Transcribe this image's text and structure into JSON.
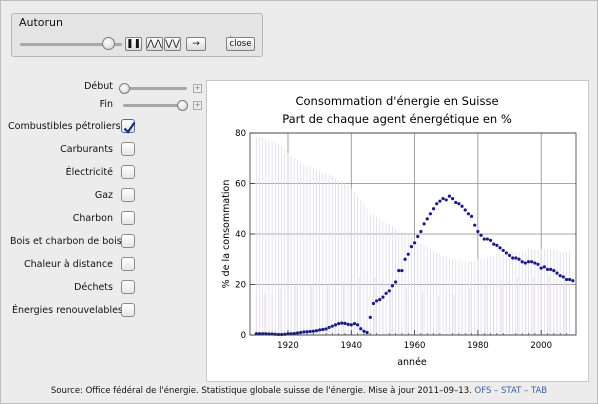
{
  "autorun": {
    "title": "Autorun",
    "slider_level": 0.85,
    "buttons": {
      "pause": "❚❚",
      "faster": "⋀⋀",
      "slower": "⋁⋁",
      "step": "→",
      "close": "close"
    }
  },
  "controls": {
    "debut": {
      "label": "Début",
      "level": 0
    },
    "fin": {
      "label": "Fin",
      "level": 1
    },
    "checkboxes": [
      {
        "label": "Combustibles pétroliers",
        "checked": true
      },
      {
        "label": "Carburants",
        "checked": false
      },
      {
        "label": "Électricité",
        "checked": false
      },
      {
        "label": "Gaz",
        "checked": false
      },
      {
        "label": "Charbon",
        "checked": false
      },
      {
        "label": "Bois et charbon de bois",
        "checked": false
      },
      {
        "label": "Chaleur à distance",
        "checked": false
      },
      {
        "label": "Déchets",
        "checked": false
      },
      {
        "label": "Énergies renouvelables",
        "checked": false
      }
    ]
  },
  "chart_data": {
    "type": "scatter",
    "title": "Consommation d'énergie en Suisse",
    "subtitle": "Part de chaque agent énergétique en %",
    "xlabel": "année",
    "ylabel": "% de la consommation",
    "xlim": [
      1908,
      2011
    ],
    "ylim": [
      0,
      80
    ],
    "xticks": [
      1920,
      1940,
      1960,
      1980,
      2000
    ],
    "yticks": [
      0,
      20,
      40,
      60,
      80
    ],
    "grid": true,
    "point_color": "#1b1b86",
    "series": [
      {
        "x": [
          1910,
          1911,
          1912,
          1913,
          1914,
          1915,
          1916,
          1917,
          1918,
          1919,
          1920,
          1921,
          1922,
          1923,
          1924,
          1925,
          1926,
          1927,
          1928,
          1929,
          1930,
          1931,
          1932,
          1933,
          1934,
          1935,
          1936,
          1937,
          1938,
          1939,
          1940,
          1941,
          1942,
          1943,
          1944,
          1945,
          1946,
          1947,
          1948,
          1949,
          1950,
          1951,
          1952,
          1953,
          1954,
          1955,
          1956,
          1957,
          1958,
          1959,
          1960,
          1961,
          1962,
          1963,
          1964,
          1965,
          1966,
          1967,
          1968,
          1969,
          1970,
          1971,
          1972,
          1973,
          1974,
          1975,
          1976,
          1977,
          1978,
          1979,
          1980,
          1981,
          1982,
          1983,
          1984,
          1985,
          1986,
          1987,
          1988,
          1989,
          1990,
          1991,
          1992,
          1993,
          1994,
          1995,
          1996,
          1997,
          1998,
          1999,
          2000,
          2001,
          2002,
          2003,
          2004,
          2005,
          2006,
          2007,
          2008,
          2009,
          2010
        ],
        "y": [
          0.5,
          0.5,
          0.5,
          0.5,
          0.4,
          0.4,
          0.3,
          0.2,
          0.2,
          0.3,
          0.5,
          0.5,
          0.6,
          0.8,
          1.0,
          1.2,
          1.3,
          1.4,
          1.5,
          1.7,
          2.0,
          2.2,
          2.4,
          3.0,
          3.5,
          4.0,
          4.5,
          4.7,
          4.6,
          4.2,
          4.0,
          4.5,
          4.0,
          2.5,
          1.5,
          1.0,
          7.0,
          12.5,
          13.5,
          14.0,
          15.0,
          16.5,
          17.5,
          19.5,
          21.0,
          25.5,
          25.5,
          30.0,
          32.0,
          35.0,
          36.5,
          39.0,
          41.0,
          44.0,
          46.0,
          48.0,
          50.0,
          52.0,
          53.0,
          54.0,
          53.5,
          55.0,
          54.0,
          52.5,
          52.0,
          51.0,
          49.5,
          48.0,
          47.0,
          43.5,
          41.0,
          39.5,
          38.0,
          38.0,
          37.5,
          36.0,
          35.5,
          34.5,
          33.5,
          32.5,
          31.5,
          30.5,
          30.5,
          30.0,
          29.0,
          28.5,
          29.0,
          29.0,
          28.5,
          28.0,
          26.5,
          27.0,
          26.0,
          26.0,
          25.5,
          24.5,
          23.5,
          23.0,
          22.0,
          22.0,
          21.5
        ]
      }
    ],
    "bands": [
      {
        "color": "#dcdced",
        "x": [
          1910,
          1912,
          1914,
          1916,
          1918,
          1920,
          1922,
          1924,
          1926,
          1928,
          1930,
          1932,
          1934,
          1936,
          1938,
          1940,
          1942,
          1944,
          1946,
          1948,
          1950,
          1952,
          1954,
          1956,
          1958,
          1960,
          1962,
          1964,
          1966,
          1968,
          1970,
          1972,
          1974,
          1976,
          1978,
          1980,
          1982,
          1984,
          1986,
          1988,
          1990,
          1992,
          1994,
          1996,
          1998,
          2000,
          2002,
          2004,
          2006,
          2008,
          2010
        ],
        "y": [
          78,
          78,
          77,
          76,
          75,
          72,
          70,
          68,
          67,
          66,
          65,
          64,
          63,
          61,
          60,
          58,
          55,
          52,
          48,
          47,
          45,
          44,
          42,
          41,
          40,
          38,
          36,
          35,
          33,
          32,
          31,
          30,
          30,
          29,
          29,
          30,
          30,
          31,
          32,
          32,
          33,
          33,
          33,
          34,
          34,
          34,
          34,
          34,
          33,
          33,
          33
        ]
      },
      {
        "color": "#ead6e2",
        "x": [
          1910,
          1915,
          1920,
          1925,
          1930,
          1935,
          1940,
          1945,
          1950,
          1955,
          1960,
          1965,
          1970,
          1975,
          1980,
          1985,
          1990,
          1995,
          2000,
          2005,
          2010
        ],
        "y": [
          16,
          17,
          19,
          20,
          20,
          20,
          22,
          24,
          22,
          20,
          18,
          16,
          15,
          17,
          20,
          21,
          22,
          23,
          23,
          24,
          24
        ]
      }
    ]
  },
  "source": {
    "text": "Source: Office fédéral de l'énergie. Statistique globale suisse de l'énergie. Mise à jour 2011–09–13.",
    "link": "OFS – STAT – TAB"
  }
}
